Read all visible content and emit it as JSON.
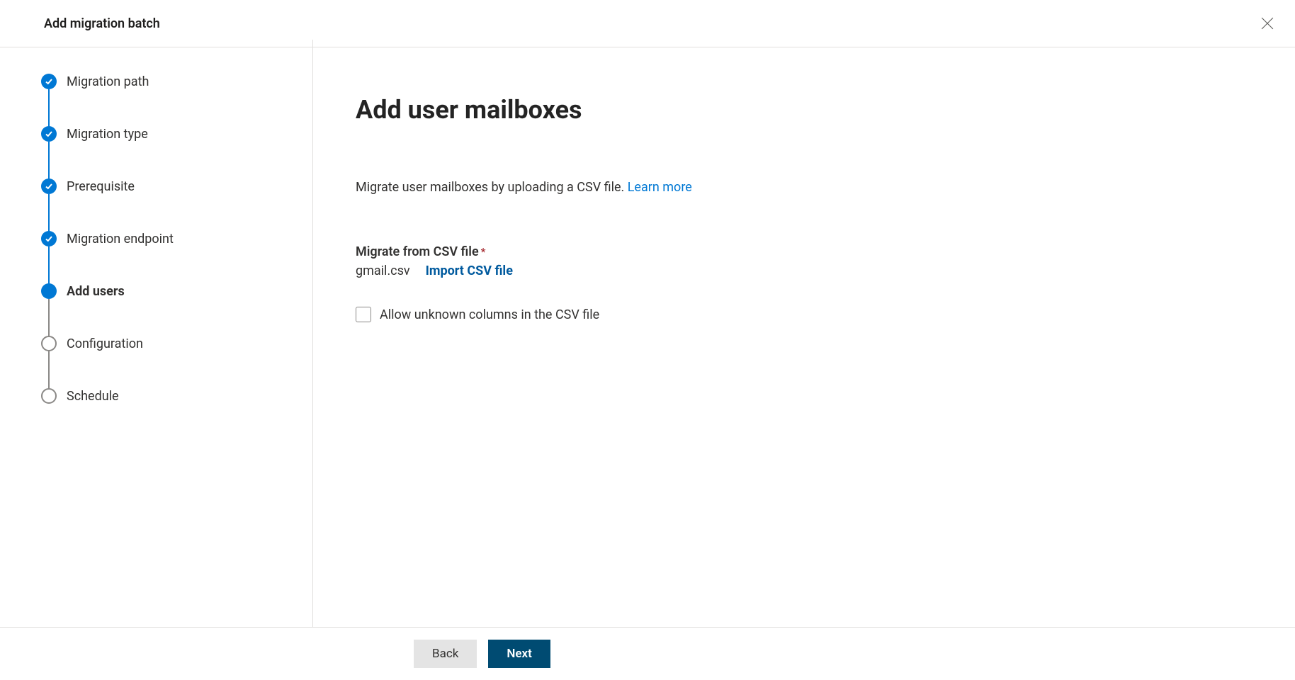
{
  "header": {
    "title": "Add migration batch"
  },
  "steps": [
    {
      "label": "Migration path",
      "state": "completed"
    },
    {
      "label": "Migration type",
      "state": "completed"
    },
    {
      "label": "Prerequisite",
      "state": "completed"
    },
    {
      "label": "Migration endpoint",
      "state": "completed"
    },
    {
      "label": "Add users",
      "state": "current"
    },
    {
      "label": "Configuration",
      "state": "pending"
    },
    {
      "label": "Schedule",
      "state": "pending"
    }
  ],
  "content": {
    "title": "Add user mailboxes",
    "description": "Migrate user mailboxes by uploading a CSV file. ",
    "learn_more": "Learn more",
    "csv_label": "Migrate from CSV file",
    "file_name": "gmail.csv",
    "import_action": "Import CSV file",
    "checkbox_label": "Allow unknown columns in the CSV file"
  },
  "footer": {
    "back": "Back",
    "next": "Next"
  }
}
